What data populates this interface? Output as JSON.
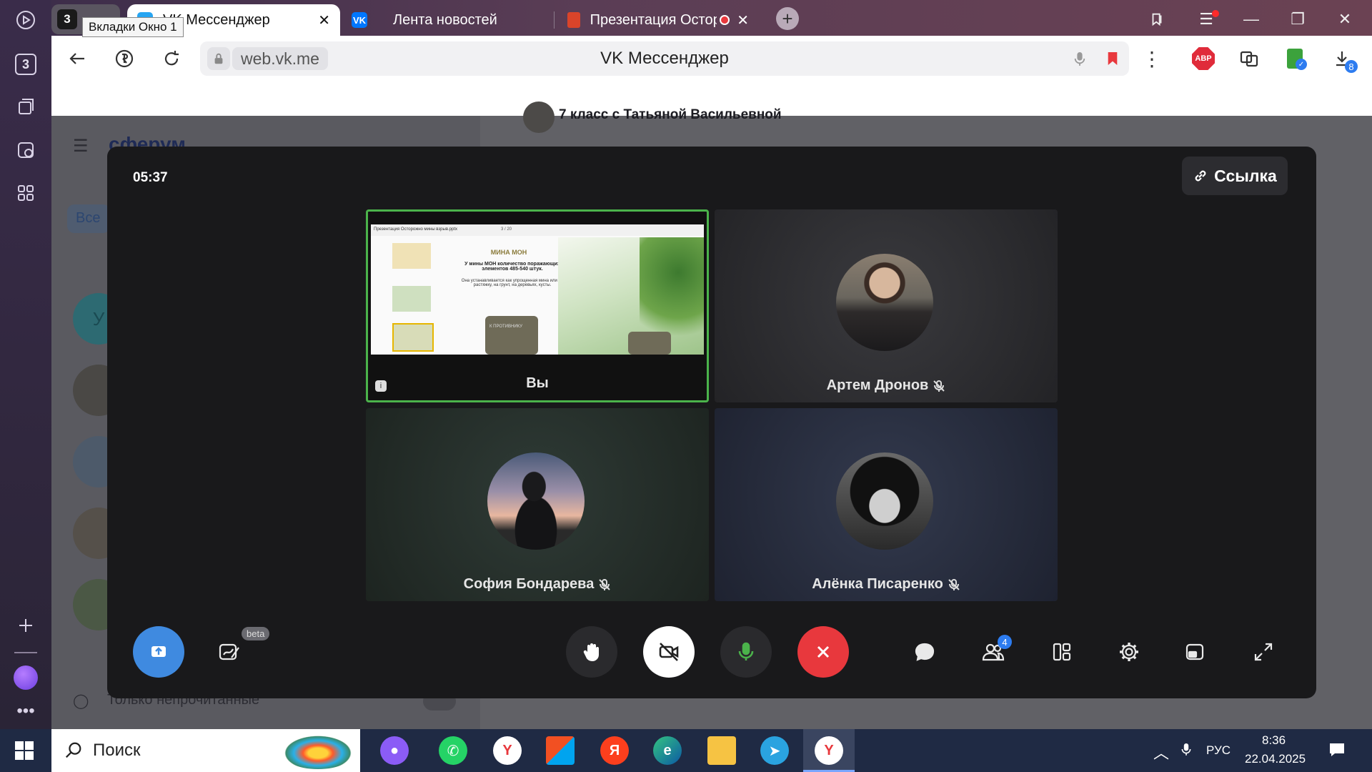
{
  "browser": {
    "tab_group_count": "3",
    "tooltip": "Вкладки Окно 1",
    "tabs": [
      {
        "label": "VK Мессенджер",
        "active": true
      },
      {
        "label": "Лента новостей",
        "active": false
      },
      {
        "label": "Презентация Остор",
        "active": false
      }
    ],
    "sidebar_count": "3",
    "url": "web.vk.me",
    "page_title": "VK Мессенджер",
    "abp_label": "ABP",
    "downloads_badge": "8"
  },
  "background": {
    "app_name": "сферум",
    "chat_title": "7 класс с Татьяной Васильевной",
    "filter_all": "Все",
    "unread_only": "Только непрочитанные",
    "avatar_letter": "У"
  },
  "call": {
    "timer": "05:37",
    "link_label": "Ссылка",
    "participants": [
      {
        "name": "Вы",
        "muted": false,
        "type": "screen"
      },
      {
        "name": "Артем Дронов",
        "muted": true,
        "type": "avatar"
      },
      {
        "name": "София Бондарева",
        "muted": true,
        "type": "avatar"
      },
      {
        "name": "Алёнка Писаренко",
        "muted": true,
        "type": "avatar"
      }
    ],
    "shared_slide": {
      "title": "Презентация Осторожно мины взрыв.pptx",
      "page": "3 / 20",
      "heading": "МИНА МОН",
      "line1": "У мины МОН количество поражающих элементов 485-540 штук.",
      "line2": "Она устанавливается как упрощенная мина или на растяжку, на грунт, на деревьях, кусты.",
      "sign": "К ПРОТИВНИКУ"
    },
    "beta_label": "beta",
    "participants_badge": "4",
    "colors": {
      "end_call": "#e8383d",
      "screen_share": "#3f8ae0",
      "active_border": "#4bb34b",
      "mic": "#4bb34b"
    }
  },
  "taskbar": {
    "search_placeholder": "Поиск",
    "lang": "РУС",
    "time": "8:36",
    "date": "22.04.2025"
  }
}
